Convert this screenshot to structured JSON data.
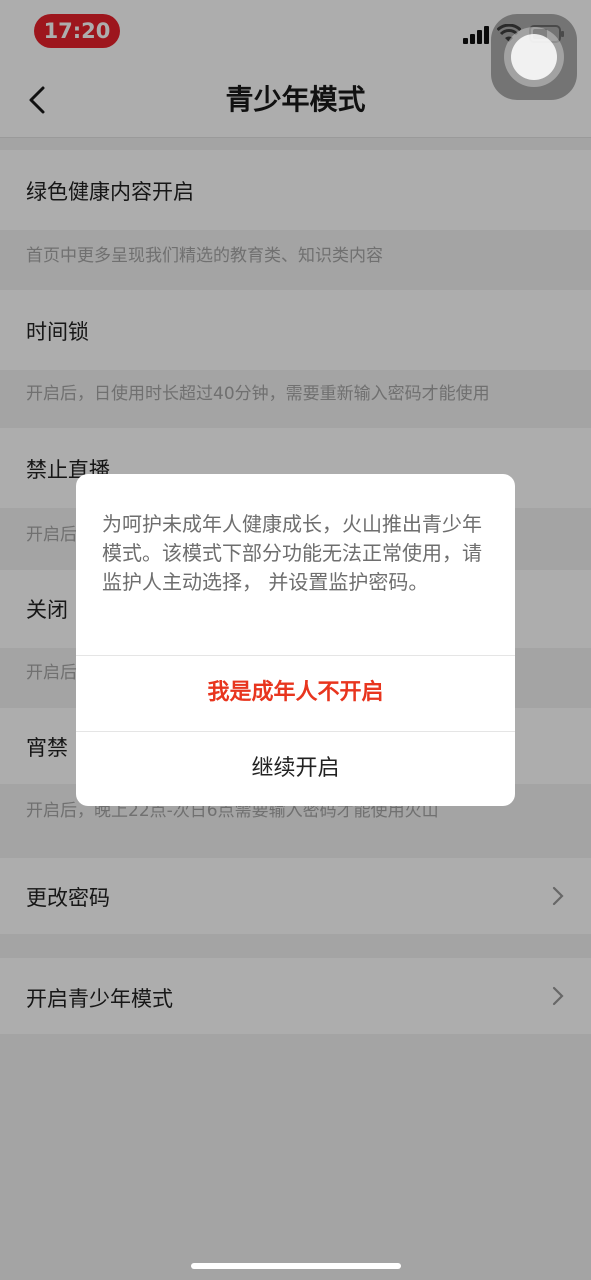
{
  "status_bar": {
    "time": "17:20",
    "accent_color": "#e8212b"
  },
  "nav": {
    "title": "青少年模式",
    "back_icon": "chevron-left-icon"
  },
  "settings": [
    {
      "title": "绿色健康内容开启",
      "desc": "首页中更多呈现我们精选的教育类、知识类内容"
    },
    {
      "title": "时间锁",
      "desc": "开启后，日使用时长超过40分钟，需要重新输入密码才能使用"
    },
    {
      "title": "禁止直播",
      "desc": "开启后"
    },
    {
      "title": "关闭",
      "desc": "开启后"
    },
    {
      "title": "宵禁",
      "desc": "开启后，晚上22点-次日6点需要输入密码才能使用火山"
    }
  ],
  "actions": [
    {
      "title": "更改密码"
    },
    {
      "title": "开启青少年模式"
    }
  ],
  "dialog": {
    "message": "为呵护未成年人健康成长，火山推出青少年模式。该模式下部分功能无法正常使用，请监护人主动选择， 并设置监护密码。",
    "decline_label": "我是成年人不开启",
    "continue_label": "继续开启",
    "decline_color": "#e8351e"
  }
}
